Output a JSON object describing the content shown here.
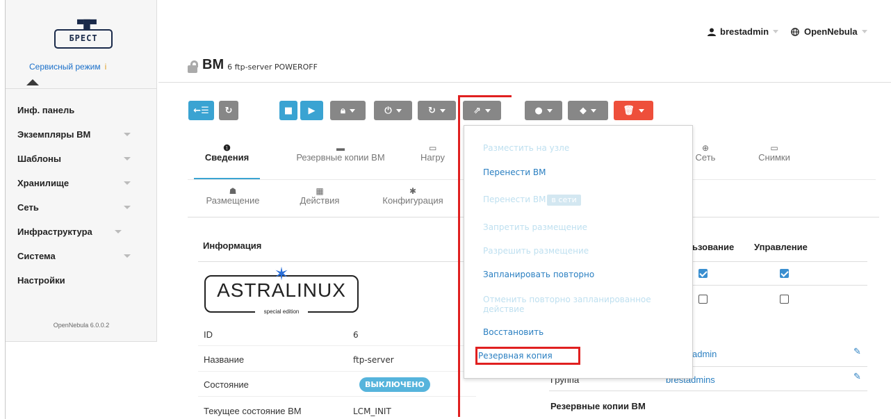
{
  "sidebar": {
    "logo_text": "БРЕСТ",
    "service_mode": "Сервисный режим",
    "items": [
      {
        "label": "Инф. панель",
        "caret": false
      },
      {
        "label": "Экземпляры ВМ",
        "caret": true
      },
      {
        "label": "Шаблоны",
        "caret": true
      },
      {
        "label": "Хранилище",
        "caret": true
      },
      {
        "label": "Сеть",
        "caret": true
      },
      {
        "label": "Инфраструктура",
        "caret": true
      },
      {
        "label": "Система",
        "caret": true
      },
      {
        "label": "Настройки",
        "caret": false
      }
    ],
    "version": "OpenNebula 6.0.0.2"
  },
  "topbar": {
    "user": "brestadmin",
    "cloud": "OpenNebula"
  },
  "header": {
    "title": "ВМ",
    "subtitle": "6 ftp-server POWEROFF"
  },
  "tabs_row1": [
    {
      "label": "Сведения",
      "icon": "info-icon",
      "active": true
    },
    {
      "label": "Резервные копии ВМ",
      "icon": "archive-icon",
      "active": false
    },
    {
      "label": "Нагру",
      "icon": "laptop-icon",
      "active": false
    },
    {
      "label": "Сеть",
      "icon": "globe-icon",
      "active": false
    },
    {
      "label": "Снимки",
      "icon": "laptop-icon",
      "active": false
    }
  ],
  "tabs_row2": [
    {
      "label": "Размещение",
      "icon": "sitemap-icon"
    },
    {
      "label": "Действия",
      "icon": "calendar-icon"
    },
    {
      "label": "Конфигурация",
      "icon": "gear-icon"
    }
  ],
  "info": {
    "heading": "Информация",
    "logo_text": "ASTRALINUX",
    "logo_sub": "special edition",
    "rows": [
      {
        "label": "ID",
        "value": "6"
      },
      {
        "label": "Название",
        "value": "ftp-server"
      },
      {
        "label": "Состояние",
        "value": "ВЫКЛЮЧЕНО"
      },
      {
        "label": "Текущее состояние ВМ",
        "value": "LCM_INIT"
      }
    ]
  },
  "permissions": {
    "col_use": "ьзование",
    "col_manage": "Управление",
    "row1_use": true,
    "row1_manage": true,
    "row2_use": false,
    "row2_manage": false
  },
  "ownership": {
    "owner_value": "admin",
    "group_label": "Группа",
    "group_value": "brestadmins",
    "backups_heading": "Резервные копии ВМ"
  },
  "dropdown": {
    "items": [
      {
        "label": "Разместить на узле",
        "enabled": false
      },
      {
        "label": "Перенести ВМ",
        "enabled": true
      },
      {
        "label": "Перенести ВМ",
        "badge": "в сети",
        "enabled": false
      },
      {
        "label": "Запретить размещение",
        "enabled": false
      },
      {
        "label": "Разрешить размещение",
        "enabled": false
      },
      {
        "label": "Запланировать повторно",
        "enabled": true
      },
      {
        "label": "Отменить повторно запланированное действие",
        "enabled": false
      },
      {
        "label": "Восстановить",
        "enabled": true
      },
      {
        "label": "Резервная копия",
        "enabled": true
      }
    ]
  },
  "colors": {
    "teal": "#3aa3d2",
    "grey": "#878787",
    "danger": "#ee4f3b",
    "link": "#2a7fc1",
    "annotation": "#e02020"
  }
}
